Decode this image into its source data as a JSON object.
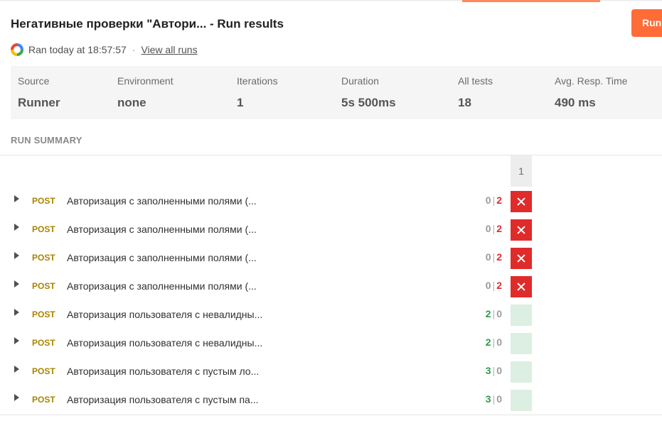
{
  "header": {
    "title": "Негативные проверки \"Автори... - Run results",
    "run_button_label": "Run",
    "ran_at": "Ran today at 18:57:57",
    "separator": "·",
    "view_all_runs": "View all runs"
  },
  "stats": [
    {
      "label": "Source",
      "value": "Runner"
    },
    {
      "label": "Environment",
      "value": "none"
    },
    {
      "label": "Iterations",
      "value": "1"
    },
    {
      "label": "Duration",
      "value": "5s 500ms"
    },
    {
      "label": "All tests",
      "value": "18"
    },
    {
      "label": "Avg. Resp. Time",
      "value": "490 ms"
    }
  ],
  "summary": {
    "title": "RUN SUMMARY",
    "iteration_header": "1"
  },
  "requests": [
    {
      "method": "POST",
      "name": "Авторизация с заполненными полями (...",
      "passed": "0",
      "failed": "2",
      "status": "failed"
    },
    {
      "method": "POST",
      "name": "Авторизация с заполненными полями (...",
      "passed": "0",
      "failed": "2",
      "status": "failed"
    },
    {
      "method": "POST",
      "name": "Авторизация с заполненными полями (...",
      "passed": "0",
      "failed": "2",
      "status": "failed"
    },
    {
      "method": "POST",
      "name": "Авторизация с заполненными полями (...",
      "passed": "0",
      "failed": "2",
      "status": "failed"
    },
    {
      "method": "POST",
      "name": "Авторизация пользователя с невалидны...",
      "passed": "2",
      "failed": "0",
      "status": "passed"
    },
    {
      "method": "POST",
      "name": "Авторизация пользователя с невалидны...",
      "passed": "2",
      "failed": "0",
      "status": "passed"
    },
    {
      "method": "POST",
      "name": "Авторизация пользователя с пустым ло...",
      "passed": "3",
      "failed": "0",
      "status": "passed"
    },
    {
      "method": "POST",
      "name": "Авторизация пользователя с пустым па...",
      "passed": "3",
      "failed": "0",
      "status": "passed"
    }
  ],
  "colors": {
    "accent": "#ff6c37",
    "fail": "#e02b2b",
    "pass": "#2a9d4a",
    "method_post": "#a98400"
  },
  "icons": {
    "runner": "runner-icon",
    "expand": "chevron-right-icon",
    "failed_cell": "close-icon"
  }
}
